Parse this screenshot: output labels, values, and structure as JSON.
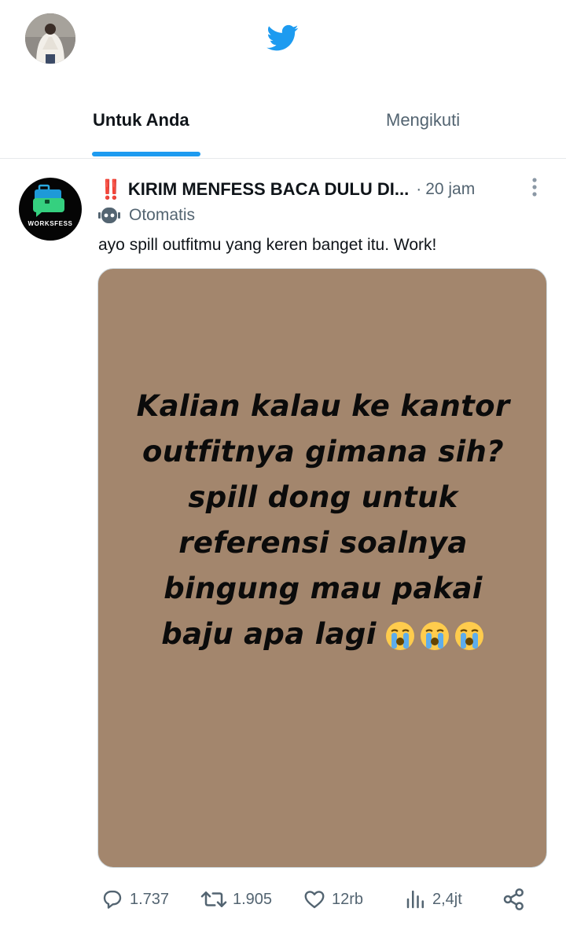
{
  "header": {
    "icons": {
      "avatar": "profile-avatar",
      "logo": "twitter-bird-icon"
    },
    "brand_color": "#1d9bf0"
  },
  "tabs": [
    {
      "label": "Untuk Anda",
      "active": true
    },
    {
      "label": "Mengikuti",
      "active": false
    }
  ],
  "tweet": {
    "author": {
      "prefix_emoji": "‼️",
      "display_name": "KIRIM MENFESS BACA DULU DI...",
      "avatar_label": "WORKSFESS"
    },
    "separator": "·",
    "time": "20 jam",
    "automated_label": "Otomatis",
    "text": "ayo spill outfitmu yang keren banget itu. Work!",
    "media": {
      "background": "#a3866d",
      "lines": [
        "Kalian kalau ke kantor",
        "outfitnya gimana sih?",
        "spill dong untuk",
        "referensi soalnya",
        "bingung mau pakai",
        "baju apa lagi"
      ],
      "emojis": [
        "crying-face",
        "crying-face",
        "crying-face"
      ]
    },
    "actions": {
      "replies": "1.737",
      "retweets": "1.905",
      "likes": "12rb",
      "views": "2,4jt"
    }
  }
}
